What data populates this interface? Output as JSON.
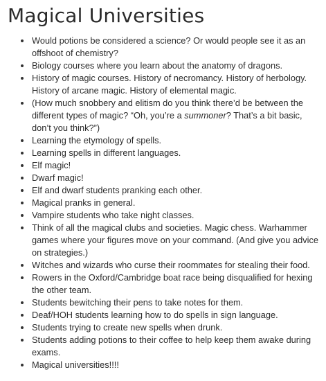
{
  "document": {
    "title": "Magical Universities",
    "items": [
      {
        "text": "Would potions be considered a science? Or would people see it as an offshoot of chemistry?"
      },
      {
        "text": "Biology courses where you learn about the anatomy of dragons."
      },
      {
        "text": "History of magic courses. History of necromancy. History of herbology. History of arcane magic. History of elemental magic."
      },
      {
        "pre": "(How much snobbery and elitism do you think there’d be between the different types of magic? “Oh, you’re a ",
        "em": "summoner",
        "post": "? That’s a bit basic, don’t you think?”)"
      },
      {
        "text": "Learning the etymology of spells."
      },
      {
        "text": "Learning spells in different languages."
      },
      {
        "text": "Elf magic!"
      },
      {
        "text": "Dwarf magic!"
      },
      {
        "text": "Elf and dwarf students pranking each other."
      },
      {
        "text": "Magical pranks in general."
      },
      {
        "text": "Vampire students who take night classes."
      },
      {
        "text": "Think of all the magical clubs and societies. Magic chess. Warhammer games where your figures move on your command. (And give you advice on strategies.)"
      },
      {
        "text": "Witches and wizards who curse their roommates for stealing their food."
      },
      {
        "text": "Rowers in the Oxford/Cambridge boat race being disqualified for hexing the other team."
      },
      {
        "text": "Students bewitching their pens to take notes for them."
      },
      {
        "text": "Deaf/HOH students learning how to do spells in sign language."
      },
      {
        "text": "Students trying to create new spells when drunk."
      },
      {
        "text": "Students adding potions to their coffee to help keep them awake during exams."
      },
      {
        "text": "Magical universities!!!!"
      }
    ]
  }
}
